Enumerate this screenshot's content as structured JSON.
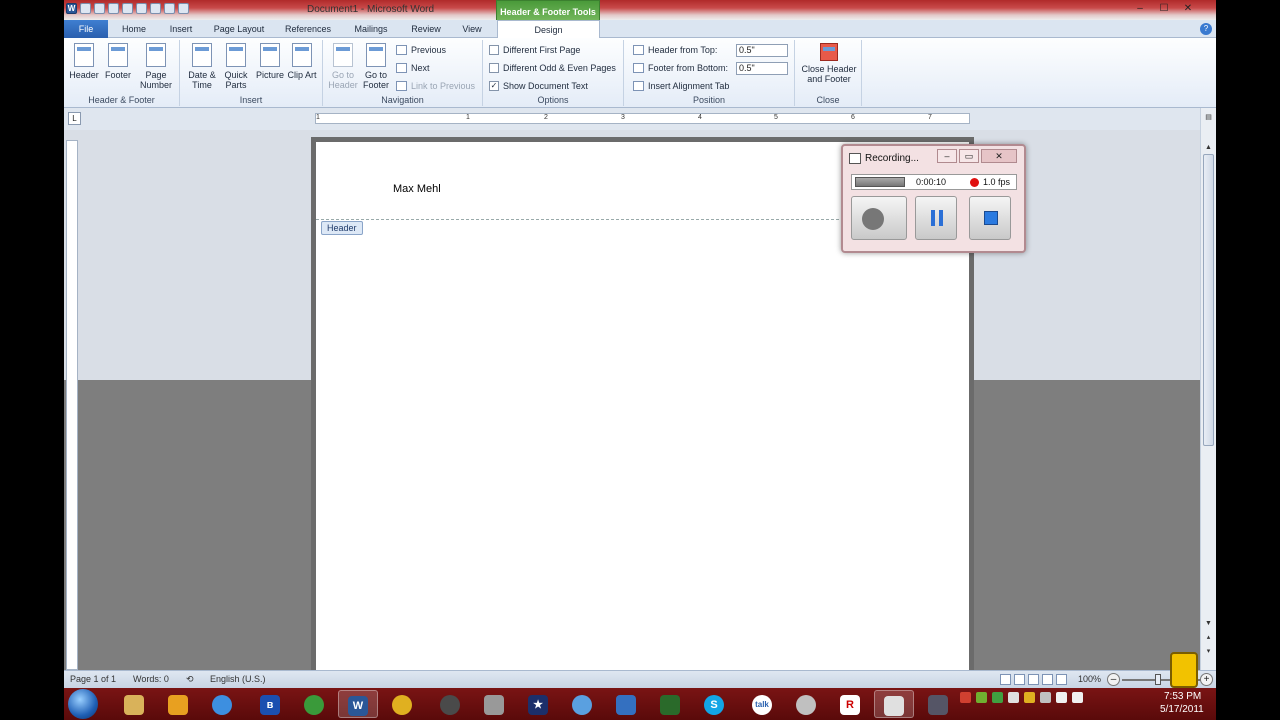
{
  "window": {
    "title": "Document1 - Microsoft Word",
    "context_tab_title": "Header & Footer Tools",
    "controls": [
      "–",
      "☐",
      "✕"
    ]
  },
  "tabs": [
    "File",
    "Home",
    "Insert",
    "Page Layout",
    "References",
    "Mailings",
    "Review",
    "View",
    "Design"
  ],
  "ribbon": {
    "header_footer_group": {
      "label": "Header & Footer",
      "buttons": [
        "Header",
        "Footer",
        "Page Number"
      ]
    },
    "insert_group": {
      "label": "Insert",
      "buttons": [
        "Date & Time",
        "Quick Parts",
        "Picture",
        "Clip Art"
      ]
    },
    "navigation_group": {
      "label": "Navigation",
      "go_to_header": "Go to Header",
      "go_to_footer": "Go to Footer",
      "previous": "Previous",
      "next": "Next",
      "link_to_previous": "Link to Previous"
    },
    "options_group": {
      "label": "Options",
      "different_first_page": "Different First Page",
      "different_odd_even": "Different Odd & Even Pages",
      "show_document_text": "Show Document Text",
      "show_document_text_checked": true
    },
    "position_group": {
      "label": "Position",
      "header_from_top_label": "Header from Top:",
      "header_from_top_value": "0.5\"",
      "footer_from_bottom_label": "Footer from Bottom:",
      "footer_from_bottom_value": "0.5\"",
      "insert_alignment_tab": "Insert Alignment Tab"
    },
    "close_group": {
      "label": "Close",
      "close_button": "Close Header and Footer"
    }
  },
  "ruler": {
    "numbers": [
      "1",
      "1",
      "2",
      "3",
      "4",
      "5",
      "6",
      "7"
    ],
    "tab_selector": "L"
  },
  "document": {
    "header_text": "Max Mehl",
    "header_tag": "Header"
  },
  "recorder": {
    "title": "Recording...",
    "time": "0:00:10",
    "fps": "1.0 fps",
    "record_color": "#e01010"
  },
  "status_bar": {
    "page": "Page 1 of 1",
    "words": "Words: 0",
    "language": "English (U.S.)",
    "zoom": "100%"
  },
  "taskbar": {
    "word_label": "W",
    "bluetooth": "ʙ",
    "skype": "S",
    "talk": "talk",
    "roblox": "R",
    "clock_time": "7:53 PM",
    "clock_date": "5/17/2011"
  }
}
